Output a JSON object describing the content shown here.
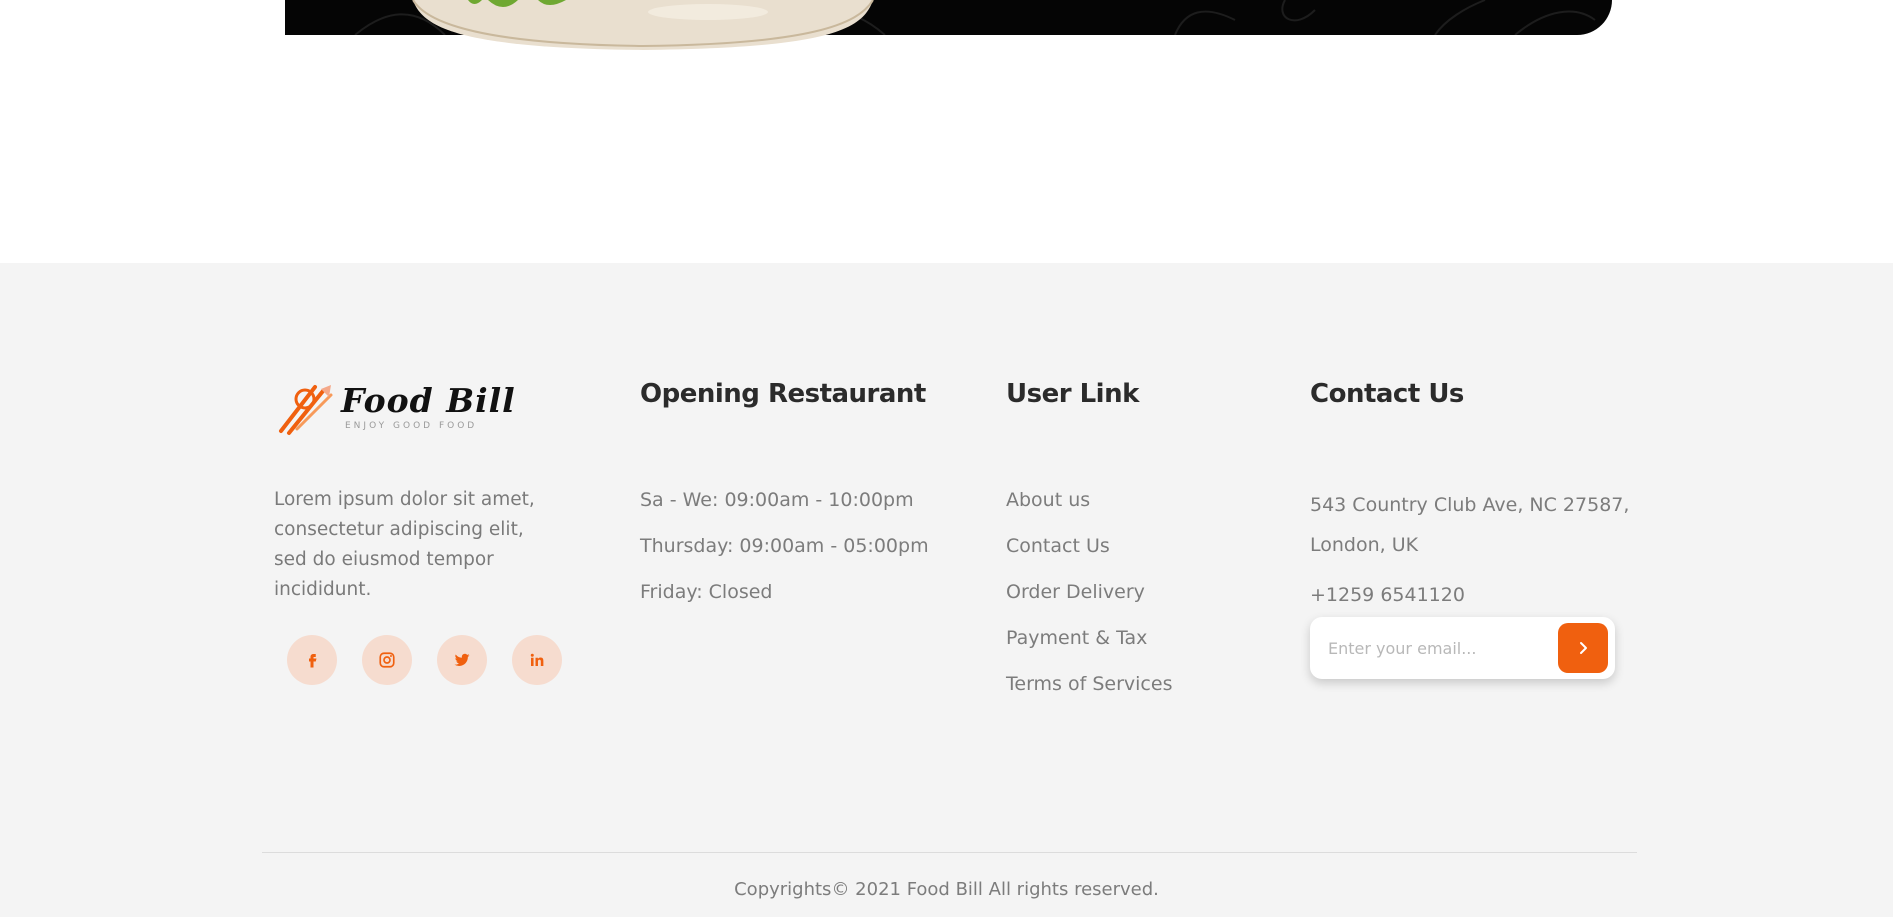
{
  "brand": {
    "name": "Food Bill",
    "tagline": "ENJOY GOOD FOOD",
    "accent_color": "#f0600f",
    "description": "Lorem ipsum dolor sit amet, consectetur adipiscing elit, sed do eiusmod tempor incididunt."
  },
  "social": [
    {
      "icon": "facebook-icon"
    },
    {
      "icon": "instagram-icon"
    },
    {
      "icon": "twitter-icon"
    },
    {
      "icon": "linkedin-icon"
    }
  ],
  "opening": {
    "title": "Opening Restaurant",
    "hours": [
      "Sa - We: 09:00am - 10:00pm",
      "Thursday: 09:00am - 05:00pm",
      "Friday: Closed"
    ]
  },
  "user_links": {
    "title": "User Link",
    "links": [
      "About us",
      "Contact Us",
      "Order Delivery",
      "Payment & Tax",
      "Terms of Services"
    ]
  },
  "contact": {
    "title": "Contact Us",
    "address": "543 Country Club Ave, NC 27587, London, UK",
    "phone": "+1259 6541120",
    "email_placeholder": "Enter your email...",
    "submit_icon": "chevron-right-icon"
  },
  "copyright": "Copyrights© 2021 Food Bill All rights reserved."
}
